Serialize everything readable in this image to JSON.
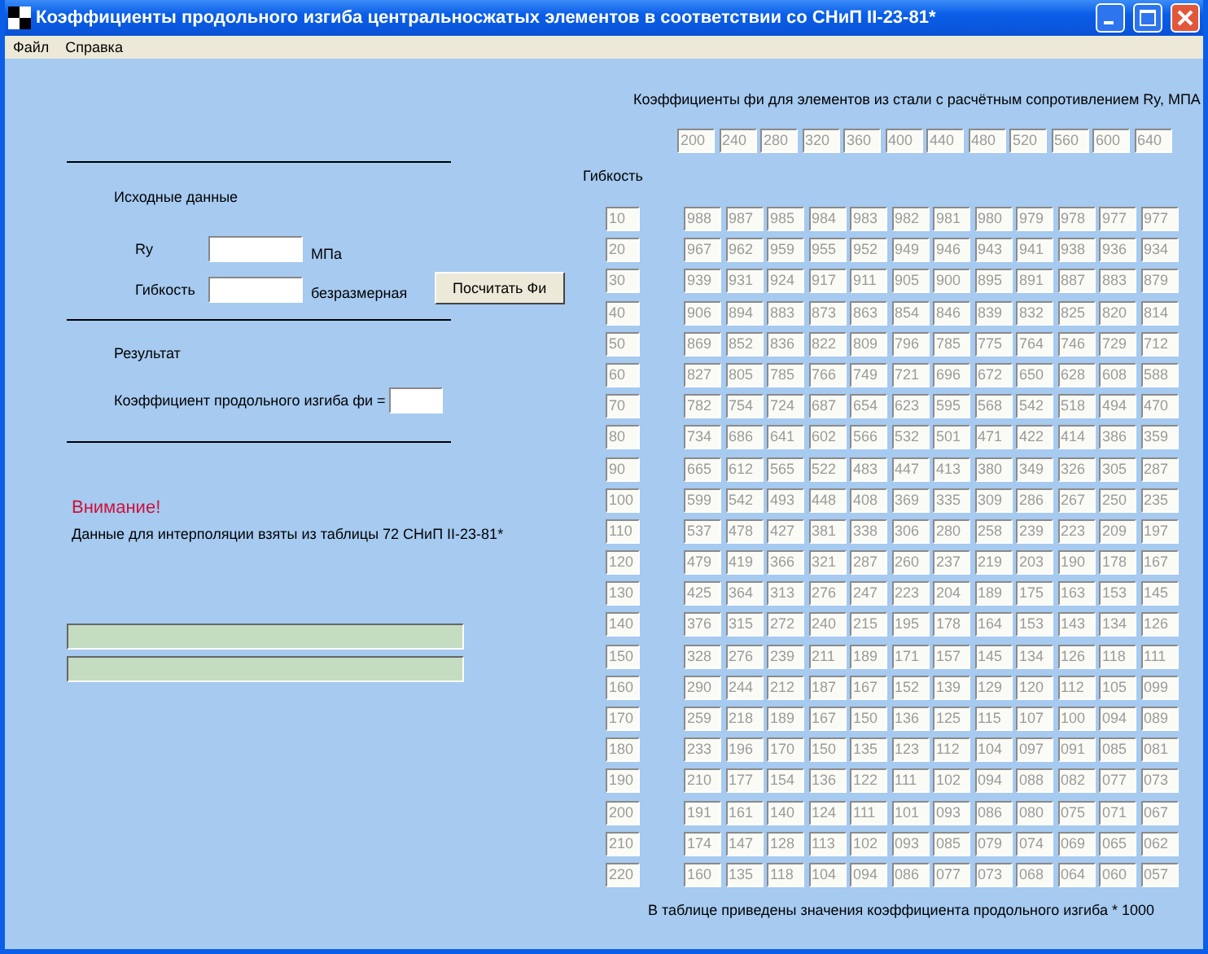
{
  "window": {
    "title": "Коэффициенты продольного изгиба центральносжатых элементов в соответствии со СНиП II-23-81*"
  },
  "menu": [
    "Файл",
    "Справка"
  ],
  "input_section": {
    "title": "Исходные данные",
    "ry_label": "Ry",
    "ry_unit": "МПа",
    "flex_label": "Гибкость",
    "flex_unit": "безразмерная",
    "button": "Посчитать Фи"
  },
  "result_section": {
    "title": "Результат",
    "label": "Коэффициент продольного изгиба фи ="
  },
  "warning": {
    "title": "Внимание!",
    "text": "Данные для интерполяции взяты из таблицы 72 СНиП II-23-81*"
  },
  "table": {
    "title": "Коэффициенты фи для элементов из стали с расчётным сопротивлением Ry, МПА",
    "row_header": "Гибкость",
    "footer": "В таблице приведены значения коэффициента продольного изгиба * 1000",
    "columns": [
      "200",
      "240",
      "280",
      "320",
      "360",
      "400",
      "440",
      "480",
      "520",
      "560",
      "600",
      "640"
    ],
    "rows": [
      {
        "label": "10",
        "values": [
          "988",
          "987",
          "985",
          "984",
          "983",
          "982",
          "981",
          "980",
          "979",
          "978",
          "977",
          "977"
        ]
      },
      {
        "label": "20",
        "values": [
          "967",
          "962",
          "959",
          "955",
          "952",
          "949",
          "946",
          "943",
          "941",
          "938",
          "936",
          "934"
        ]
      },
      {
        "label": "30",
        "values": [
          "939",
          "931",
          "924",
          "917",
          "911",
          "905",
          "900",
          "895",
          "891",
          "887",
          "883",
          "879"
        ]
      },
      {
        "label": "40",
        "values": [
          "906",
          "894",
          "883",
          "873",
          "863",
          "854",
          "846",
          "839",
          "832",
          "825",
          "820",
          "814"
        ]
      },
      {
        "label": "50",
        "values": [
          "869",
          "852",
          "836",
          "822",
          "809",
          "796",
          "785",
          "775",
          "764",
          "746",
          "729",
          "712"
        ]
      },
      {
        "label": "60",
        "values": [
          "827",
          "805",
          "785",
          "766",
          "749",
          "721",
          "696",
          "672",
          "650",
          "628",
          "608",
          "588"
        ]
      },
      {
        "label": "70",
        "values": [
          "782",
          "754",
          "724",
          "687",
          "654",
          "623",
          "595",
          "568",
          "542",
          "518",
          "494",
          "470"
        ]
      },
      {
        "label": "80",
        "values": [
          "734",
          "686",
          "641",
          "602",
          "566",
          "532",
          "501",
          "471",
          "422",
          "414",
          "386",
          "359"
        ]
      },
      {
        "label": "90",
        "values": [
          "665",
          "612",
          "565",
          "522",
          "483",
          "447",
          "413",
          "380",
          "349",
          "326",
          "305",
          "287"
        ]
      },
      {
        "label": "100",
        "values": [
          "599",
          "542",
          "493",
          "448",
          "408",
          "369",
          "335",
          "309",
          "286",
          "267",
          "250",
          "235"
        ]
      },
      {
        "label": "110",
        "values": [
          "537",
          "478",
          "427",
          "381",
          "338",
          "306",
          "280",
          "258",
          "239",
          "223",
          "209",
          "197"
        ]
      },
      {
        "label": "120",
        "values": [
          "479",
          "419",
          "366",
          "321",
          "287",
          "260",
          "237",
          "219",
          "203",
          "190",
          "178",
          "167"
        ]
      },
      {
        "label": "130",
        "values": [
          "425",
          "364",
          "313",
          "276",
          "247",
          "223",
          "204",
          "189",
          "175",
          "163",
          "153",
          "145"
        ]
      },
      {
        "label": "140",
        "values": [
          "376",
          "315",
          "272",
          "240",
          "215",
          "195",
          "178",
          "164",
          "153",
          "143",
          "134",
          "126"
        ]
      },
      {
        "label": "150",
        "values": [
          "328",
          "276",
          "239",
          "211",
          "189",
          "171",
          "157",
          "145",
          "134",
          "126",
          "118",
          "111"
        ]
      },
      {
        "label": "160",
        "values": [
          "290",
          "244",
          "212",
          "187",
          "167",
          "152",
          "139",
          "129",
          "120",
          "112",
          "105",
          "099"
        ]
      },
      {
        "label": "170",
        "values": [
          "259",
          "218",
          "189",
          "167",
          "150",
          "136",
          "125",
          "115",
          "107",
          "100",
          "094",
          "089"
        ]
      },
      {
        "label": "180",
        "values": [
          "233",
          "196",
          "170",
          "150",
          "135",
          "123",
          "112",
          "104",
          "097",
          "091",
          "085",
          "081"
        ]
      },
      {
        "label": "190",
        "values": [
          "210",
          "177",
          "154",
          "136",
          "122",
          "111",
          "102",
          "094",
          "088",
          "082",
          "077",
          "073"
        ]
      },
      {
        "label": "200",
        "values": [
          "191",
          "161",
          "140",
          "124",
          "111",
          "101",
          "093",
          "086",
          "080",
          "075",
          "071",
          "067"
        ]
      },
      {
        "label": "210",
        "values": [
          "174",
          "147",
          "128",
          "113",
          "102",
          "093",
          "085",
          "079",
          "074",
          "069",
          "065",
          "062"
        ]
      },
      {
        "label": "220",
        "values": [
          "160",
          "135",
          "118",
          "104",
          "094",
          "086",
          "077",
          "073",
          "068",
          "064",
          "060",
          "057"
        ]
      }
    ]
  }
}
